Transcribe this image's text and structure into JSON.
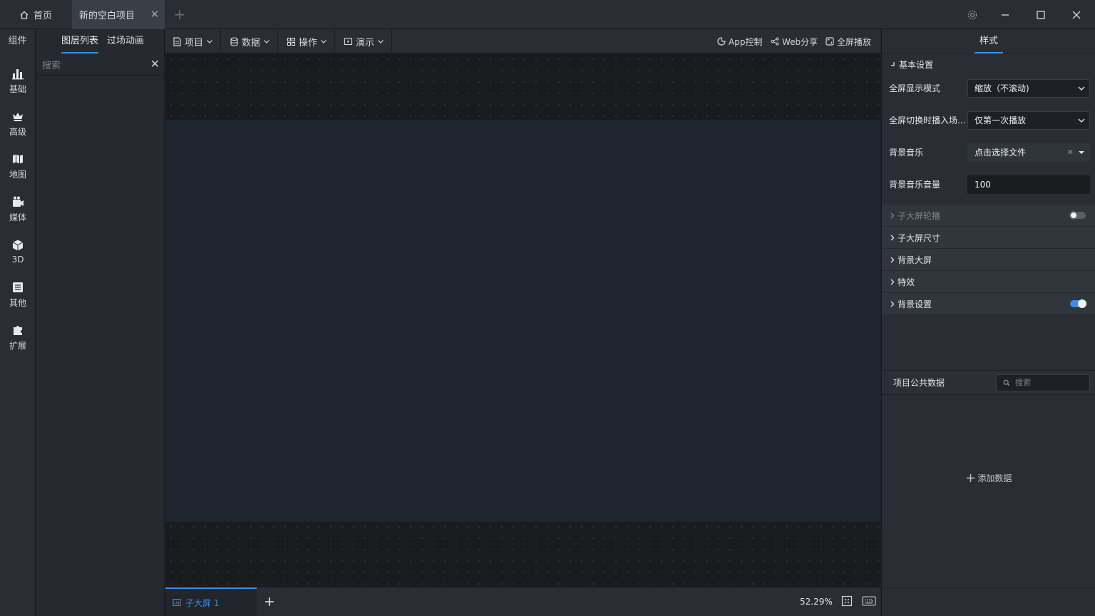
{
  "titlebar": {
    "home_tab": "首页",
    "active_tab": "新的空白项目",
    "close_tab": "✕",
    "add_tab": "+"
  },
  "window_controls": {
    "settings": "settings-icon",
    "minimize": "minimize-icon",
    "maximize": "maximize-icon",
    "close": "close-icon"
  },
  "components_panel": {
    "header": "组件",
    "categories": [
      {
        "label": "基础",
        "icon": "bar-chart-icon"
      },
      {
        "label": "高级",
        "icon": "crown-icon"
      },
      {
        "label": "地图",
        "icon": "map-icon"
      },
      {
        "label": "媒体",
        "icon": "media-icon"
      },
      {
        "label": "3D",
        "icon": "cube-icon"
      },
      {
        "label": "其他",
        "icon": "list-icon"
      },
      {
        "label": "扩展",
        "icon": "puzzle-icon"
      }
    ]
  },
  "layer_panel": {
    "tabs": [
      "图层列表",
      "过场动画"
    ],
    "search_placeholder": "搜索"
  },
  "toolbar": {
    "menus": [
      "项目",
      "数据",
      "操作",
      "演示"
    ],
    "app_control": "App控制",
    "web_share": "Web分享",
    "fullscreen_play": "全屏播放"
  },
  "canvas": {
    "sub_screen_tab": "子大屏 1",
    "zoom": "52.29%"
  },
  "style_panel": {
    "tab": "样式",
    "basic_section": "基本设置",
    "fields": [
      {
        "label": "全屏显示模式",
        "value": "缩放（不滚动)"
      },
      {
        "label": "全屏切换时播入场...",
        "value": "仅第一次播放"
      },
      {
        "label": "背景音乐",
        "value": "点击选择文件"
      },
      {
        "label": "背景音乐音量",
        "value": "100"
      }
    ],
    "collapsibles": [
      {
        "label": "子大屏轮播",
        "toggle": false,
        "dimmed": true
      },
      {
        "label": "子大屏尺寸"
      },
      {
        "label": "背景大屏"
      },
      {
        "label": "特效"
      },
      {
        "label": "背景设置",
        "toggle": true
      }
    ],
    "accent": "#3a8ee6"
  },
  "public_data": {
    "title": "项目公共数据",
    "search_placeholder": "搜索",
    "add_label": "添加数据"
  }
}
